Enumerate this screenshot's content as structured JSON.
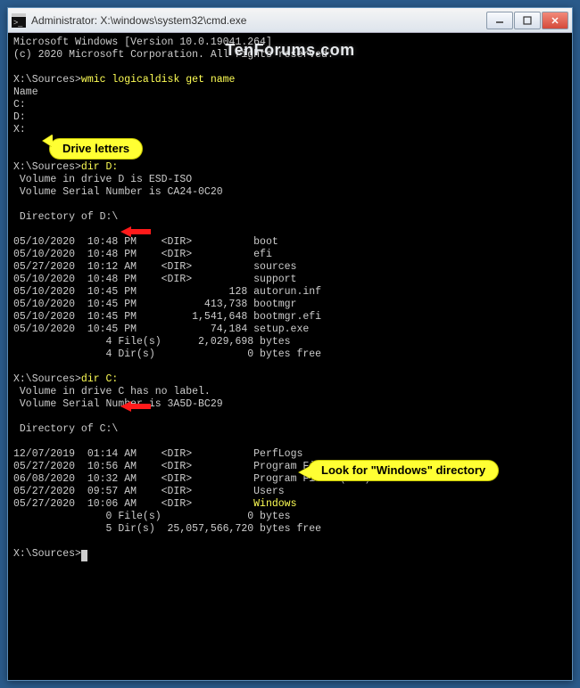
{
  "window": {
    "title": "Administrator: X:\\windows\\system32\\cmd.exe"
  },
  "watermark": "TenForums.com",
  "callouts": {
    "drive_letters": "Drive letters",
    "windows_dir": "Look for \"Windows\" directory"
  },
  "header": {
    "line1": "Microsoft Windows [Version 10.0.19041.264]",
    "line2": "(c) 2020 Microsoft Corporation. All rights reserved."
  },
  "prompts": {
    "p1_path": "X:\\Sources>",
    "p1_cmd": "wmic logicaldisk get name",
    "p2_path": "X:\\Sources>",
    "p2_cmd": "dir D:",
    "p3_path": "X:\\Sources>",
    "p3_cmd": "dir C:",
    "p4_path": "X:\\Sources>"
  },
  "wmic": {
    "header": "Name",
    "rows": [
      "C:",
      "D:",
      "X:"
    ]
  },
  "dirD": {
    "vol": " Volume in drive D is ESD-ISO",
    "serial": " Volume Serial Number is CA24-0C20",
    "of": " Directory of D:\\",
    "rows": [
      "05/10/2020  10:48 PM    <DIR>          boot",
      "05/10/2020  10:48 PM    <DIR>          efi",
      "05/27/2020  10:12 AM    <DIR>          sources",
      "05/10/2020  10:48 PM    <DIR>          support",
      "05/10/2020  10:45 PM               128 autorun.inf",
      "05/10/2020  10:45 PM           413,738 bootmgr",
      "05/10/2020  10:45 PM         1,541,648 bootmgr.efi",
      "05/10/2020  10:45 PM            74,184 setup.exe"
    ],
    "sum1": "               4 File(s)      2,029,698 bytes",
    "sum2": "               4 Dir(s)               0 bytes free"
  },
  "dirC": {
    "vol": " Volume in drive C has no label.",
    "serial": " Volume Serial Number is 3A5D-BC29",
    "of": " Directory of C:\\",
    "rows": [
      {
        "pfx": "12/07/2019  01:14 AM    <DIR>          ",
        "name": "PerfLogs",
        "hl": false
      },
      {
        "pfx": "05/27/2020  10:56 AM    <DIR>          ",
        "name": "Program Files",
        "hl": false
      },
      {
        "pfx": "06/08/2020  10:32 AM    <DIR>          ",
        "name": "Program Files (x86)",
        "hl": false
      },
      {
        "pfx": "05/27/2020  09:57 AM    <DIR>          ",
        "name": "Users",
        "hl": false
      },
      {
        "pfx": "05/27/2020  10:06 AM    <DIR>          ",
        "name": "Windows",
        "hl": true
      }
    ],
    "sum1": "               0 File(s)              0 bytes",
    "sum2": "               5 Dir(s)  25,057,566,720 bytes free"
  }
}
